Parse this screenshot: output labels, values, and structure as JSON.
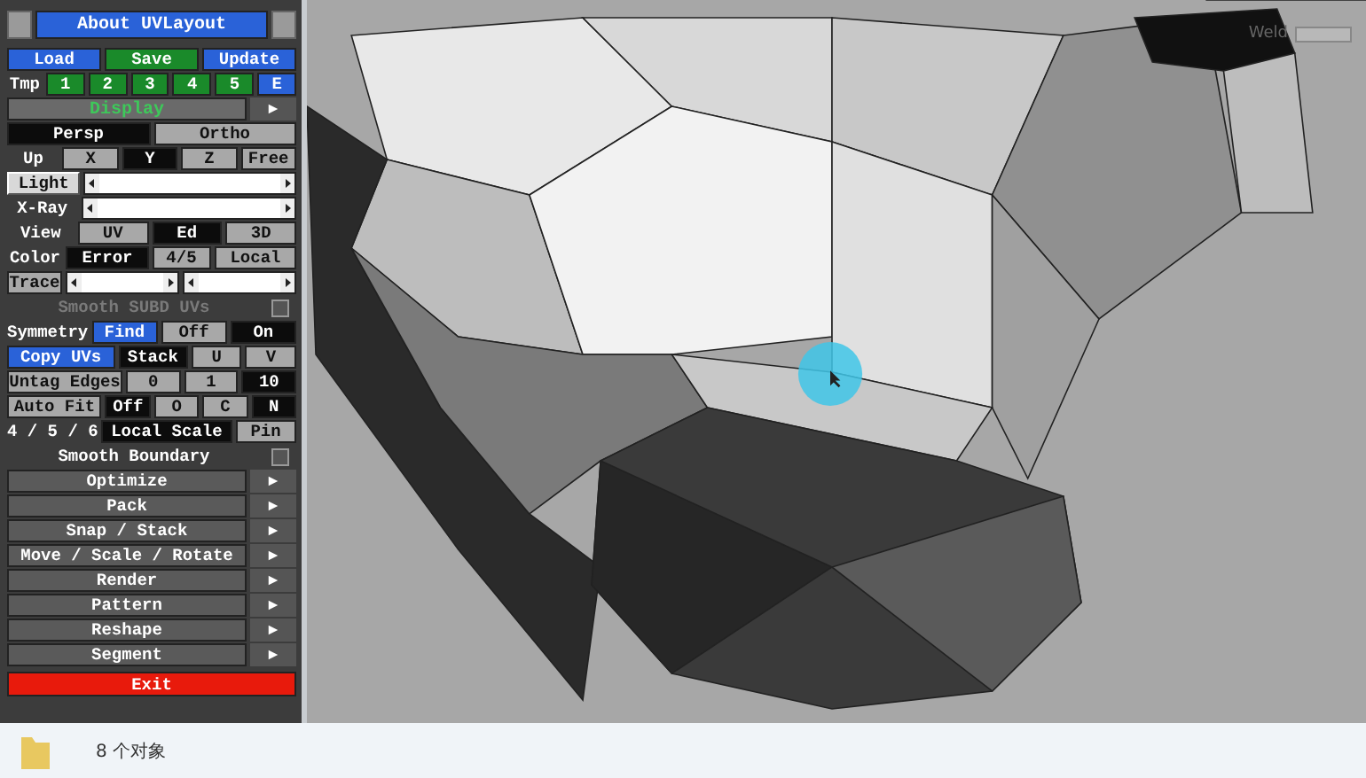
{
  "toolbox": {
    "about": "About UVLayout",
    "rows": [
      {
        "items": [
          {
            "kind": "bluebutton",
            "text": "Load"
          },
          {
            "kind": "greenbutton",
            "text": "Save"
          },
          {
            "kind": "bluebutton",
            "text": "Update"
          }
        ]
      },
      {
        "items": [
          {
            "kind": "label",
            "text": "Tmp"
          },
          {
            "kind": "greenbutton",
            "text": "1"
          },
          {
            "kind": "greenbutton",
            "text": "2"
          },
          {
            "kind": "greenbutton",
            "text": "3"
          },
          {
            "kind": "greenbutton",
            "text": "4"
          },
          {
            "kind": "greenbutton",
            "text": "5"
          },
          {
            "kind": "bluebutton",
            "text": "E"
          }
        ]
      },
      {
        "items": [
          {
            "kind": "section",
            "text": "Display"
          }
        ]
      },
      {
        "items": [
          {
            "kind": "button",
            "text": "Persp",
            "selected": true
          },
          {
            "kind": "button",
            "text": "Ortho",
            "selected": false
          }
        ]
      },
      {
        "items": [
          {
            "kind": "label",
            "text": "Up"
          },
          {
            "kind": "button",
            "text": "X",
            "selected": false
          },
          {
            "kind": "button",
            "text": "Y",
            "selected": true
          },
          {
            "kind": "button",
            "text": "Z",
            "selected": false
          },
          {
            "kind": "button",
            "text": "Free",
            "selected": false
          }
        ]
      },
      {
        "items": [
          {
            "kind": "raisedbutton",
            "text": "Light"
          },
          {
            "kind": "slider"
          }
        ]
      },
      {
        "items": [
          {
            "kind": "label",
            "text": "X-Ray"
          },
          {
            "kind": "slider"
          }
        ]
      },
      {
        "items": [
          {
            "kind": "label",
            "text": "View"
          },
          {
            "kind": "button",
            "text": "UV",
            "selected": false
          },
          {
            "kind": "button",
            "text": "Ed",
            "selected": true
          },
          {
            "kind": "button",
            "text": "3D",
            "selected": false
          }
        ]
      },
      {
        "items": [
          {
            "kind": "label",
            "text": "Color"
          },
          {
            "kind": "button",
            "text": "Error",
            "selected": true
          },
          {
            "kind": "button",
            "text": "4/5",
            "selected": false
          },
          {
            "kind": "button",
            "text": "Local",
            "selected": false
          }
        ]
      },
      {
        "items": [
          {
            "kind": "button",
            "text": "Trace",
            "selected": false
          },
          {
            "kind": "slider"
          },
          {
            "kind": "slider"
          }
        ]
      },
      {
        "items": [
          {
            "kind": "check",
            "text": "Smooth SUBD UVs",
            "checked": false,
            "disabled": true
          }
        ]
      },
      {
        "items": [
          {
            "kind": "label",
            "text": "Symmetry"
          },
          {
            "kind": "bluebutton",
            "text": "Find"
          },
          {
            "kind": "button",
            "text": "Off",
            "selected": false
          },
          {
            "kind": "button",
            "text": "On",
            "selected": true
          }
        ]
      },
      {
        "items": [
          {
            "kind": "bluebutton",
            "text": "Copy UVs"
          },
          {
            "kind": "button",
            "text": "Stack",
            "selected": true
          },
          {
            "kind": "button",
            "text": "U",
            "selected": false
          },
          {
            "kind": "button",
            "text": "V",
            "selected": false
          }
        ]
      },
      {
        "items": [
          {
            "kind": "button",
            "text": "Untag Edges",
            "selected": false
          },
          {
            "kind": "button",
            "text": "0",
            "selected": false
          },
          {
            "kind": "button",
            "text": "1",
            "selected": false
          },
          {
            "kind": "button",
            "text": "10",
            "selected": true
          }
        ]
      },
      {
        "items": [
          {
            "kind": "button",
            "text": "Auto Fit",
            "selected": false
          },
          {
            "kind": "button",
            "text": "Off",
            "selected": true
          },
          {
            "kind": "button",
            "text": "O",
            "selected": false
          },
          {
            "kind": "button",
            "text": "C",
            "selected": false
          },
          {
            "kind": "button",
            "text": "N",
            "selected": true
          }
        ]
      },
      {
        "items": [
          {
            "kind": "label",
            "text": "4 / 5 / 6"
          },
          {
            "kind": "button",
            "text": "Local Scale",
            "selected": true
          },
          {
            "kind": "button",
            "text": "Pin",
            "selected": false
          }
        ]
      },
      {
        "items": [
          {
            "kind": "check",
            "text": "Smooth Boundary",
            "checked": false,
            "disabled": false
          }
        ]
      }
    ],
    "menus": [
      "Optimize",
      "Pack",
      "Snap / Stack",
      "Move / Scale / Rotate",
      "Render",
      "Pattern",
      "Reshape",
      "Segment"
    ],
    "exit": "Exit"
  },
  "viewport": {
    "weld_label": "Weld"
  },
  "status_bar": {
    "text": "8 个对象"
  }
}
